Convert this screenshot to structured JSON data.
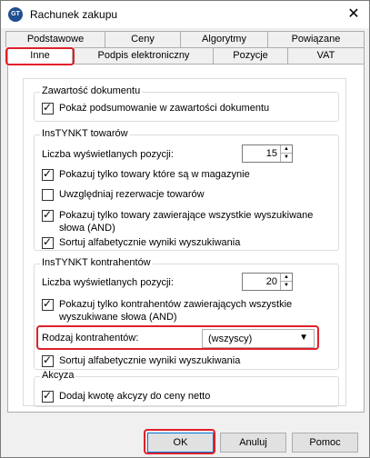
{
  "window": {
    "title": "Rachunek zakupu",
    "app_icon_text": "GT",
    "close_glyph": "✕"
  },
  "tabs": {
    "row1": [
      "Podstawowe",
      "Ceny",
      "Algorytmy",
      "Powiązane"
    ],
    "row2": [
      "Inne",
      "Podpis elektroniczny",
      "Pozycje",
      "VAT"
    ],
    "active": "Inne"
  },
  "document_group": {
    "title": "Zawartość dokumentu",
    "show_summary": {
      "label": "Pokaż podsumowanie w zawartości dokumentu",
      "checked": true
    }
  },
  "products_group": {
    "title": "InsTYNKT towarów",
    "count_label": "Liczba wyświetlanych pozycji:",
    "count_value": "15",
    "only_in_stock": {
      "label": "Pokazuj tylko towary które są w magazynie",
      "checked": true
    },
    "include_reservations": {
      "label": "Uwzględniaj rezerwacje towarów",
      "checked": false
    },
    "all_words": {
      "label_line1": "Pokazuj tylko towary zawierające wszystkie wyszukiwane",
      "label_line2": "słowa (AND)",
      "checked": true
    },
    "sort_alpha": {
      "label": "Sortuj alfabetycznie wyniki wyszukiwania",
      "checked": true
    }
  },
  "contractors_group": {
    "title": "InsTYNKT kontrahentów",
    "count_label": "Liczba wyświetlanych pozycji:",
    "count_value": "20",
    "all_words": {
      "label_line1": "Pokazuj tylko kontrahentów zawierających wszystkie",
      "label_line2": "wyszukiwane słowa (AND)",
      "checked": true
    },
    "type_label": "Rodzaj kontrahentów:",
    "type_value": "(wszyscy)",
    "sort_alpha": {
      "label": "Sortuj alfabetycznie wyniki wyszukiwania",
      "checked": true
    }
  },
  "excise_group": {
    "title": "Akcyza",
    "add_excise": {
      "label": "Dodaj kwotę akcyzy do ceny netto",
      "checked": true
    }
  },
  "buttons": {
    "ok": "OK",
    "cancel": "Anuluj",
    "help": "Pomoc"
  },
  "colors": {
    "highlight": "#e0202a",
    "default_button_border": "#0078d7"
  }
}
